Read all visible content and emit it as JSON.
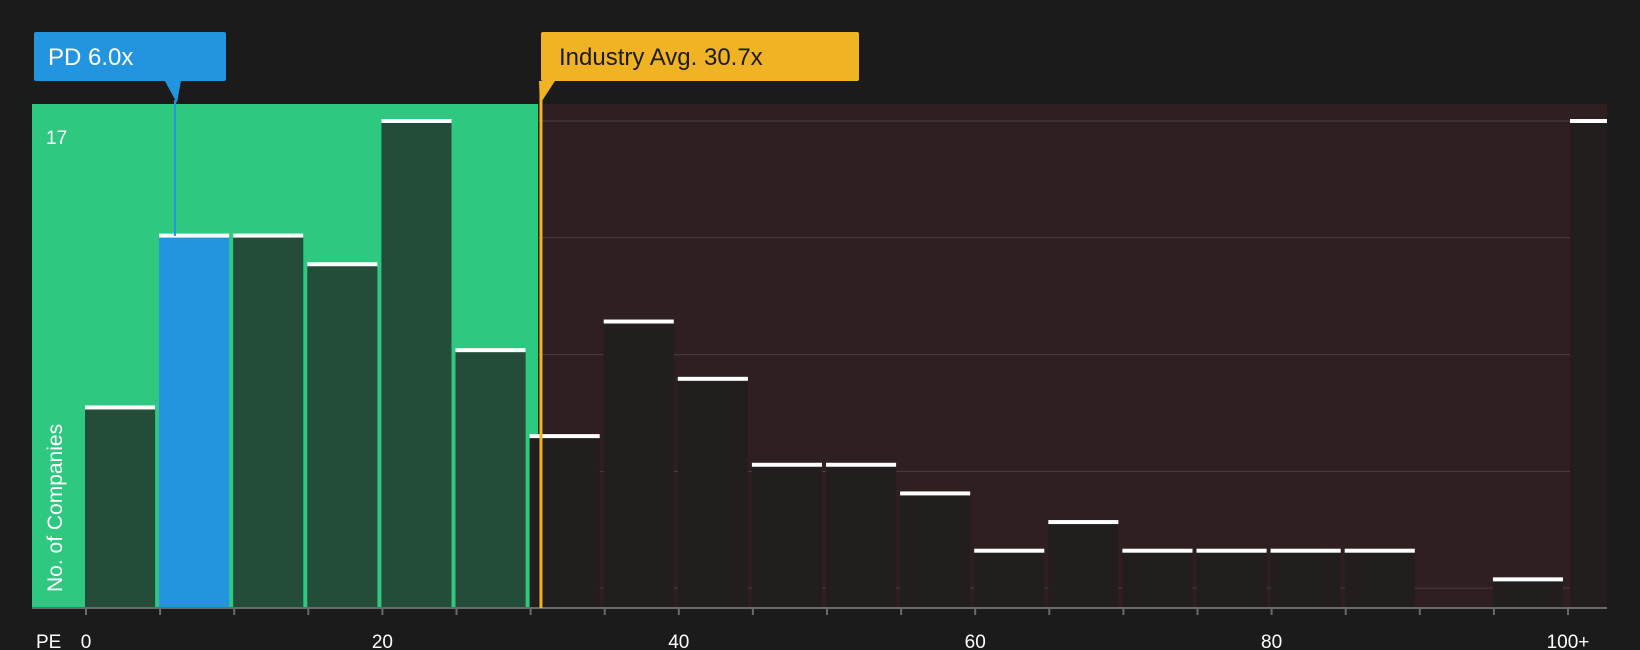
{
  "chart_data": {
    "type": "bar",
    "title": "",
    "xlabel": "PE",
    "ylabel": "No. of Companies",
    "x_tick_labels": [
      "0",
      "20",
      "40",
      "60",
      "80",
      "100+"
    ],
    "x_tick_values": [
      0,
      20,
      40,
      60,
      80,
      100
    ],
    "y_max_label": "17",
    "ylim": [
      0,
      17
    ],
    "xlim": [
      -3.5,
      103
    ],
    "bin_width": 5,
    "bins_start": [
      0,
      5,
      10,
      15,
      20,
      25,
      30,
      35,
      40,
      45,
      50,
      55,
      60,
      65,
      70,
      75,
      80,
      85,
      90,
      95,
      100
    ],
    "values": [
      7,
      13,
      13,
      12,
      17,
      9,
      6,
      10,
      8,
      5,
      5,
      4,
      2,
      3,
      2,
      2,
      2,
      2,
      0,
      1,
      17
    ],
    "highlight_bin": 1,
    "company_marker": {
      "label": "PD 6.0x",
      "value": 6.0,
      "color": "#2394e0"
    },
    "industry_marker": {
      "label": "Industry Avg. 30.7x",
      "value": 30.7,
      "color": "#f0b323"
    },
    "regions": {
      "undervalued_color": "#2ec880",
      "overvalued_color": "#2f1f20",
      "boundary": 29.5
    },
    "grid": true,
    "colors": {
      "background": "#1b1b1b",
      "bar_in_green": "#234c39",
      "bar_in_red": "#221e1e",
      "bar_highlight": "#2394e0",
      "bar_top": "#ffffff",
      "gridline": "#4a3f40"
    }
  }
}
